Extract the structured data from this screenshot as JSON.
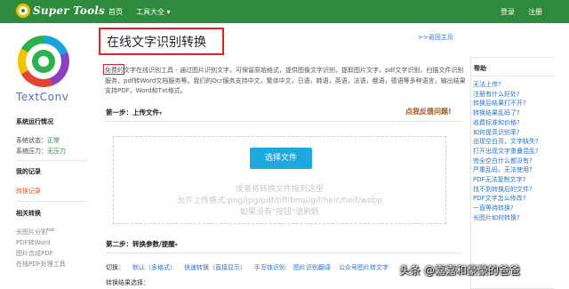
{
  "navbar": {
    "brand": "Super Tools",
    "home": "首页",
    "tools": "工具大全",
    "tools_caret": "▾",
    "login": "登录",
    "register": "注册"
  },
  "sidebar": {
    "logo_text": "TextConv",
    "status_heading": "系统运行情况",
    "status_label": "系统状态：",
    "status_value": "正常",
    "load_label": "系统压力：",
    "load_value": "无压力",
    "records_heading": "我的记录",
    "records_link": "转换记录",
    "related_heading": "相关转换",
    "related_items": [
      {
        "label": "长图片分割",
        "badge": "hot"
      },
      {
        "label": "PDF转Word",
        "badge": ""
      },
      {
        "label": "图片合成PDF",
        "badge": ""
      },
      {
        "label": "在线PDF处理工具",
        "badge": ""
      }
    ]
  },
  "main": {
    "title": "在线文字识别转换",
    "back_link": ">>返回主页",
    "intro": "免费的文字在线识别工具 - 通过图片识别文字，可保留原始格式，提供图像文字识别，提取图片文字，pdf文字识别，扫描文件识别服务，pdf转Word文档服务等。我们的Ocr服务支持中文，繁体中文，日语，韩语，英语，法语，俄语，德语等多种语言，输出结果支持PDF，Word和Txt格式。",
    "step1": "第一步：上传文件",
    "step_caret": "▾",
    "feedback": "点我反馈问题!",
    "upload_button": "选择文件",
    "drop_hint": "或者将转换文件拖到这里",
    "formats_hint": "允许上传格式:png/jpg/pdf/tiff/bmp/gif/heic/heif/webp",
    "refresh_hint": "如果没有\"按钮\"请刷新",
    "step2": "第二步：转换参数/提醒",
    "switch_label": "切换：",
    "tabs": [
      "默认（多格式）",
      "快速转换（直接显示）",
      "手写体识别",
      "图片识别翻译",
      "公众号图片转文字"
    ],
    "result_label": "转换结果选择："
  },
  "help": {
    "title": "帮助",
    "items": [
      "无法上传?",
      "注册有什么好处?",
      "转换后结果打不开?",
      "转换结果乱码了?",
      "收费标准和价格?",
      "如何提高识别率?",
      "出现空白页，文字缺失?",
      "打开出现文字重叠混乱?",
      "完全空白什么都没有?",
      "严重乱码，无法使用?",
      "PDF无法复制文字?",
      "找不到转换后的文件?",
      "PDF文字怎么修改?",
      "一直等待转换?",
      "长图片如何转换?"
    ]
  },
  "watermark": "头条 @嘉嘉和豪豪的爸爸",
  "colors": {
    "navbar": "#2e8b3d",
    "accent_button": "#1da9e0",
    "highlight_frame": "#e0202a",
    "link": "#2a74c8"
  }
}
